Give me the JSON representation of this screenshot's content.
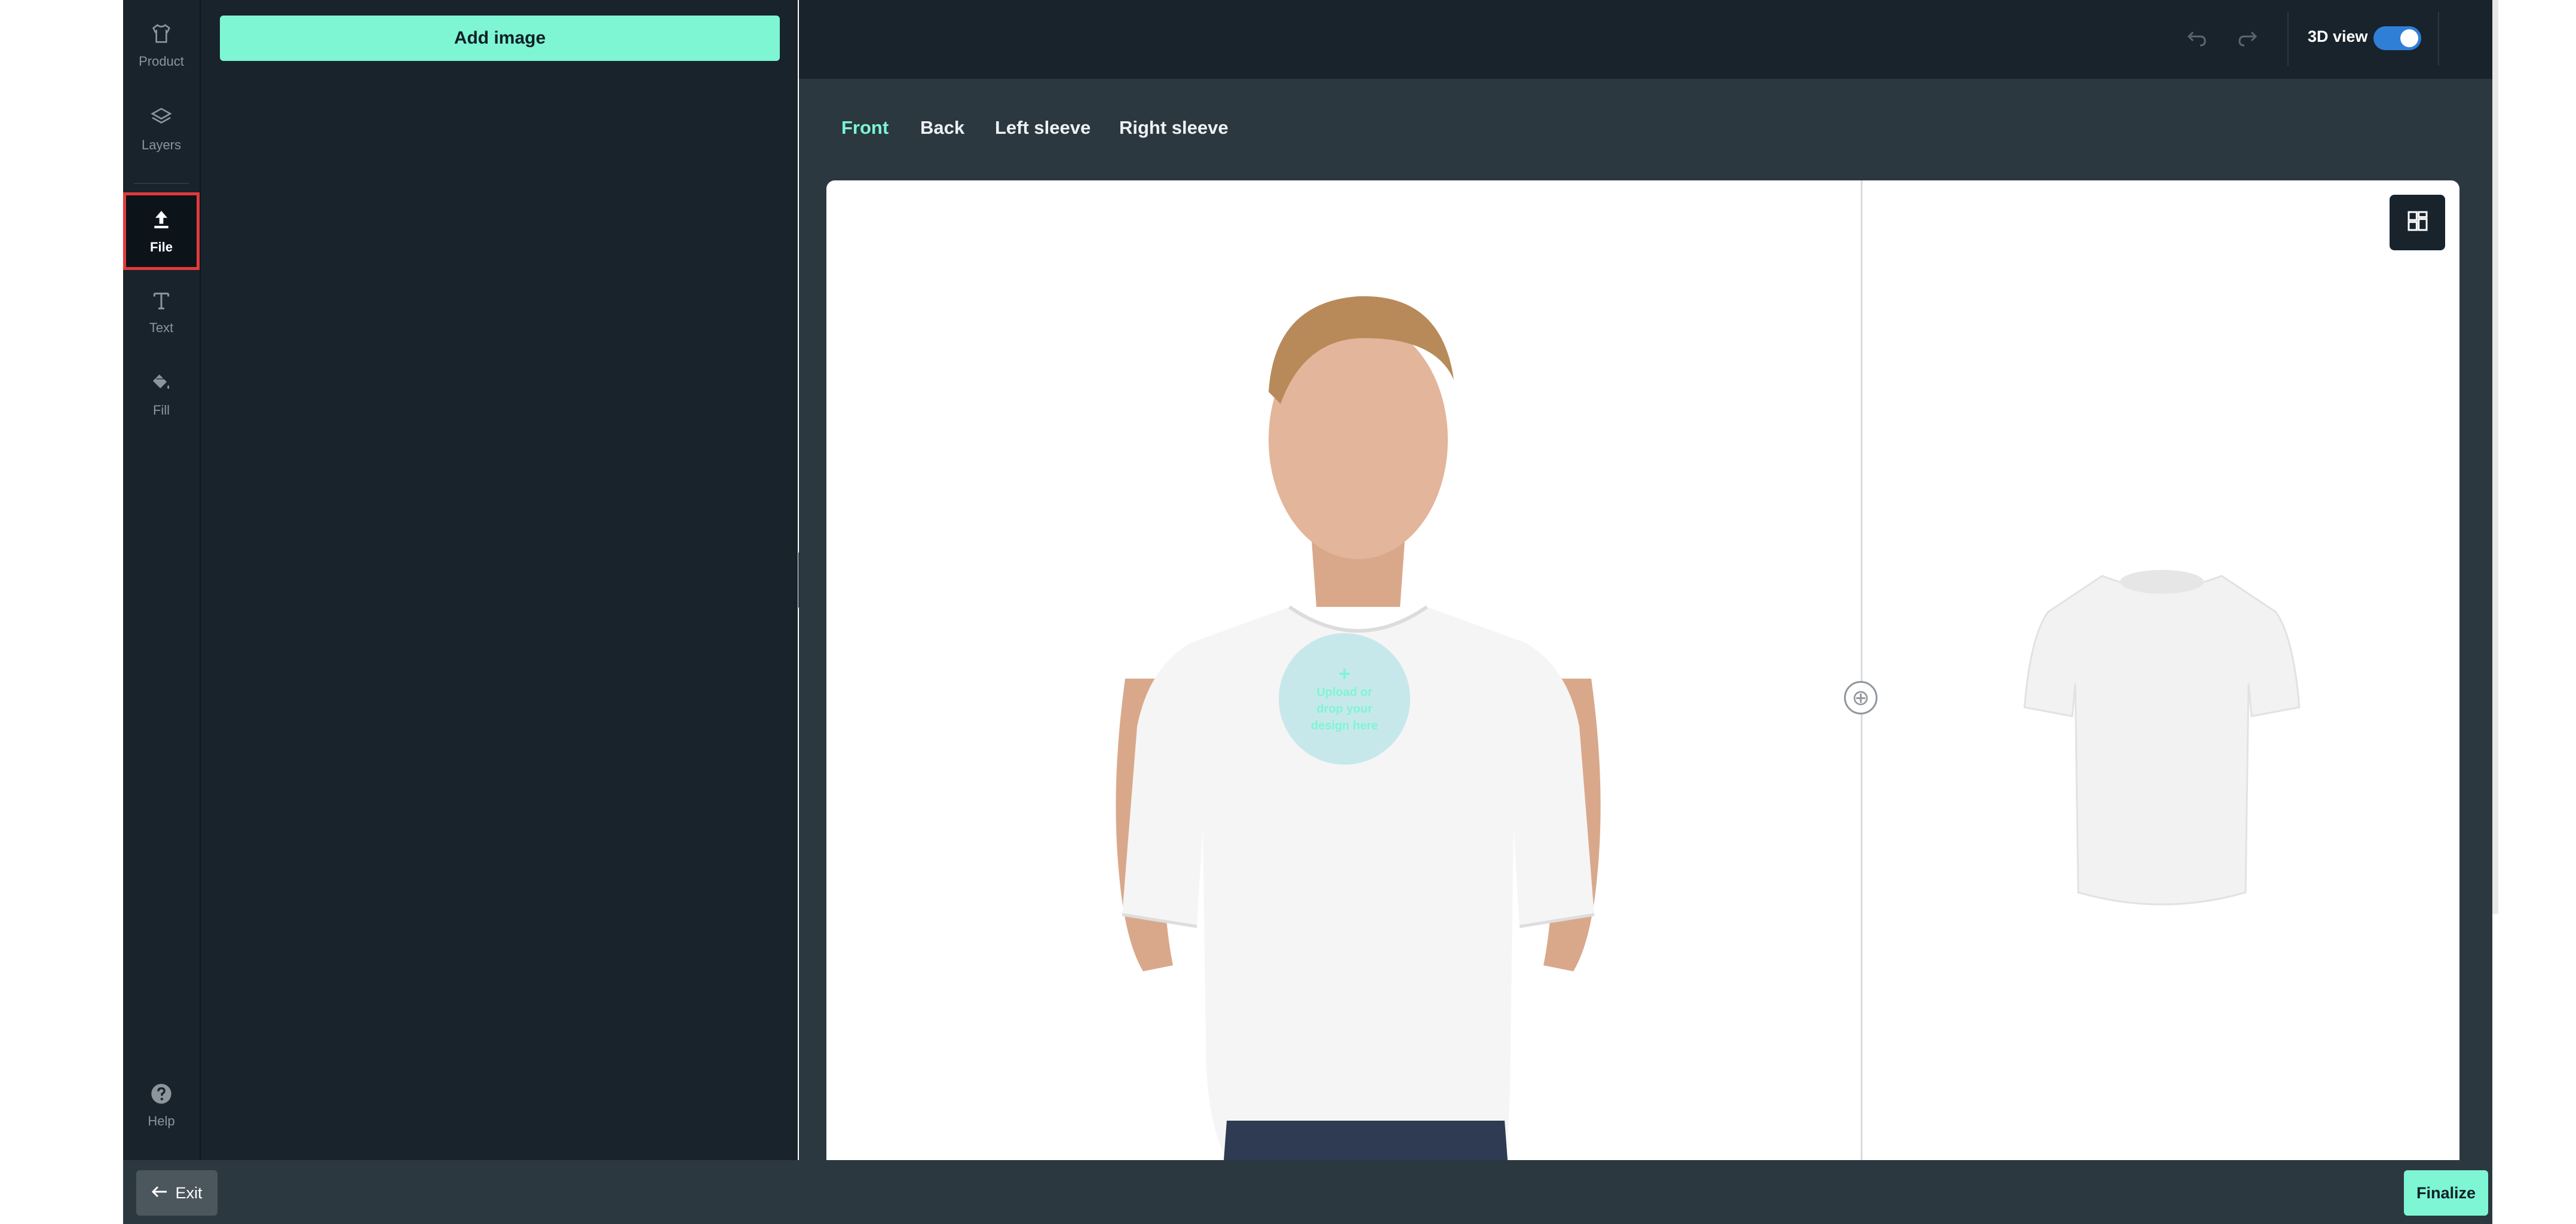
{
  "sidebar": {
    "items": [
      {
        "label": "Product",
        "icon": "shirt-icon"
      },
      {
        "label": "Layers",
        "icon": "layers-icon"
      },
      {
        "label": "File",
        "icon": "upload-icon",
        "active": true
      },
      {
        "label": "Text",
        "icon": "text-icon"
      },
      {
        "label": "Fill",
        "icon": "paint-bucket-icon"
      }
    ],
    "help_label": "Help"
  },
  "panel": {
    "add_image_label": "Add image"
  },
  "topbar": {
    "view3d_label": "3D view",
    "view3d_enabled": true
  },
  "tabs": [
    {
      "label": "Front",
      "active": true
    },
    {
      "label": "Back"
    },
    {
      "label": "Left sleeve"
    },
    {
      "label": "Right sleeve"
    }
  ],
  "canvas": {
    "dropzone_text": "Upload or drop your design here"
  },
  "footer": {
    "exit_label": "Exit",
    "finalize_label": "Finalize"
  },
  "colors": {
    "accent": "#7ef5d3",
    "toggle": "#2f7fd6",
    "panel": "#18232c",
    "highlight": "#e23a3a"
  }
}
